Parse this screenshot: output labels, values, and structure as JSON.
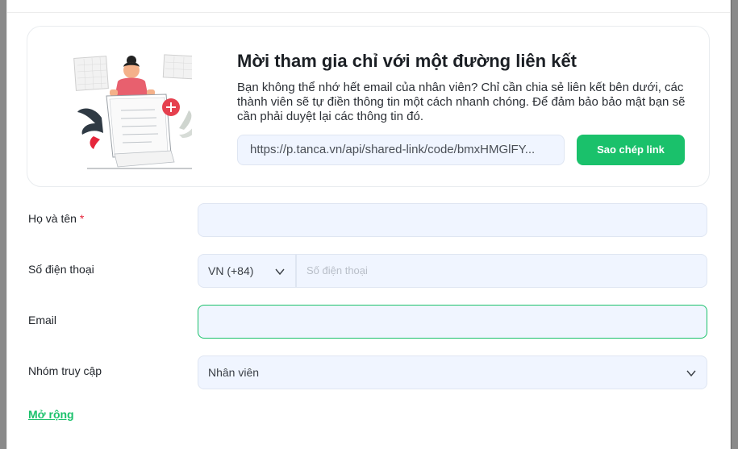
{
  "invite": {
    "title": "Mời tham gia chỉ với một đường liên kết",
    "description": "Bạn không thể nhớ hết email của nhân viên? Chỉ cần chia sẻ liên kết bên dưới, các thành viên sẽ tự điền thông tin một cách nhanh chóng. Để đảm bảo bảo mật bạn sẽ cần phải duyệt lại các thông tin đó.",
    "link_value": "https://p.tanca.vn/api/shared-link/code/bmxHMGlFY...",
    "copy_label": "Sao chép link"
  },
  "form": {
    "full_name": {
      "label": "Họ và tên",
      "required_mark": "*",
      "value": ""
    },
    "phone": {
      "label": "Số điện thoại",
      "country_code": "VN (+84)",
      "placeholder": "Số điện thoại",
      "value": ""
    },
    "email": {
      "label": "Email",
      "value": ""
    },
    "access_group": {
      "label": "Nhóm truy cập",
      "value": "Nhân viên"
    }
  },
  "expand_label": "Mở rộng",
  "colors": {
    "accent": "#1ac16b",
    "field_bg": "#f0f5ff",
    "required": "#e5263b"
  }
}
